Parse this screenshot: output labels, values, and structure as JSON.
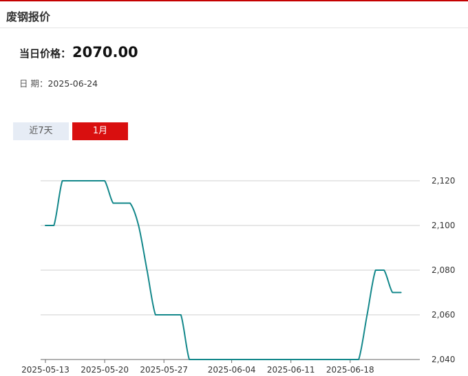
{
  "header": {
    "title": "废钢报价"
  },
  "price": {
    "label": "当日价格：",
    "value": "2070.00"
  },
  "date": {
    "label": "日 期：",
    "value": "2025-06-24"
  },
  "tabs": [
    {
      "label": "近7天",
      "active": false
    },
    {
      "label": "1月",
      "active": true
    }
  ],
  "colors": {
    "accent": "#d90f0f",
    "line": "#12878a",
    "tab_inactive": "#e6ecf5"
  },
  "chart_data": {
    "type": "line",
    "title": "",
    "xlabel": "",
    "ylabel": "",
    "x_ticks": [
      "2025-05-13",
      "2025-05-20",
      "2025-05-27",
      "2025-06-04",
      "2025-06-11",
      "2025-06-18"
    ],
    "y_ticks": [
      2040,
      2060,
      2080,
      2100,
      2120
    ],
    "ylim": [
      2040,
      2120
    ],
    "y_axis_position": "right",
    "grid": "horizontal",
    "series": [
      {
        "x": [
          "2025-05-13",
          "2025-05-14",
          "2025-05-15",
          "2025-05-16",
          "2025-05-17",
          "2025-05-18",
          "2025-05-19",
          "2025-05-20",
          "2025-05-21",
          "2025-05-22",
          "2025-05-23",
          "2025-05-24",
          "2025-05-25",
          "2025-05-26",
          "2025-05-27",
          "2025-05-28",
          "2025-05-29",
          "2025-05-30",
          "2025-05-31",
          "2025-06-01",
          "2025-06-02",
          "2025-06-03",
          "2025-06-04",
          "2025-06-05",
          "2025-06-06",
          "2025-06-07",
          "2025-06-08",
          "2025-06-09",
          "2025-06-10",
          "2025-06-11",
          "2025-06-12",
          "2025-06-13",
          "2025-06-14",
          "2025-06-15",
          "2025-06-16",
          "2025-06-17",
          "2025-06-18",
          "2025-06-19",
          "2025-06-20",
          "2025-06-21",
          "2025-06-22",
          "2025-06-23",
          "2025-06-24"
        ],
        "values": [
          2100,
          2100,
          2120,
          2120,
          2120,
          2120,
          2120,
          2120,
          2110,
          2110,
          2110,
          2100,
          2080,
          2060,
          2060,
          2060,
          2060,
          2040,
          2040,
          2040,
          2040,
          2040,
          2040,
          2040,
          2040,
          2040,
          2040,
          2040,
          2040,
          2040,
          2040,
          2040,
          2040,
          2040,
          2040,
          2040,
          2040,
          2040,
          2060,
          2080,
          2080,
          2070,
          2070
        ]
      }
    ]
  }
}
